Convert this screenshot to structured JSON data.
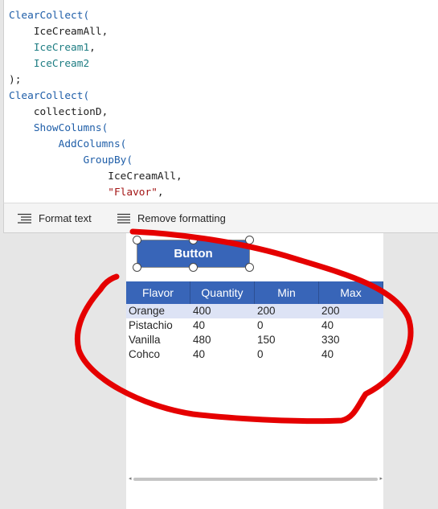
{
  "editor": {
    "code_lines": [
      [
        {
          "t": "ClearCollect(",
          "k": "fn"
        }
      ],
      [
        {
          "t": "    IceCreamAll,",
          "k": "id"
        }
      ],
      [
        {
          "t": "    IceCream1",
          "k": "ref"
        },
        {
          "t": ",",
          "k": "p"
        }
      ],
      [
        {
          "t": "    IceCream2",
          "k": "ref"
        }
      ],
      [
        {
          "t": ");",
          "k": "p"
        }
      ],
      [
        {
          "t": "ClearCollect(",
          "k": "fn"
        }
      ],
      [
        {
          "t": "    collectionD,",
          "k": "id"
        }
      ],
      [
        {
          "t": "    ShowColumns(",
          "k": "fn"
        }
      ],
      [
        {
          "t": "        AddColumns(",
          "k": "fn"
        }
      ],
      [
        {
          "t": "            GroupBy(",
          "k": "fn"
        }
      ],
      [
        {
          "t": "                IceCreamAll,",
          "k": "id"
        }
      ],
      [
        {
          "t": "                \"Flavor\"",
          "k": "str"
        },
        {
          "t": ",",
          "k": "p"
        }
      ]
    ]
  },
  "toolbar": {
    "format_text_label": "Format text",
    "remove_formatting_label": "Remove formatting"
  },
  "canvas": {
    "button_label": "Button",
    "table": {
      "headers": [
        "Flavor",
        "Quantity",
        "Min",
        "Max"
      ],
      "rows": [
        {
          "flavor": "Orange",
          "quantity": "400",
          "min": "200",
          "max": "200"
        },
        {
          "flavor": "Pistachio",
          "quantity": "40",
          "min": "0",
          "max": "40"
        },
        {
          "flavor": "Vanilla",
          "quantity": "480",
          "min": "150",
          "max": "330"
        },
        {
          "flavor": "Cohco",
          "quantity": "40",
          "min": "0",
          "max": "40"
        }
      ],
      "selected_row": 0
    }
  },
  "colors": {
    "accent": "#3865b8",
    "annotation": "#e50000",
    "selected_row": "#dde3f5"
  }
}
